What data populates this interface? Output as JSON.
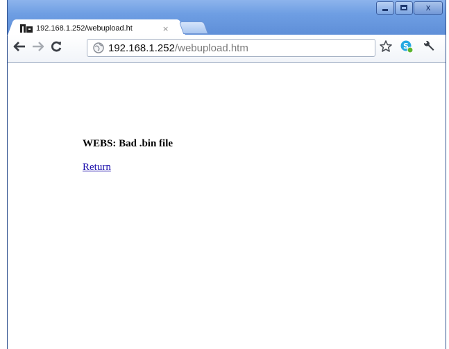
{
  "browser": {
    "tab": {
      "title": "192.168.1.252/webupload.ht",
      "close_glyph": "×",
      "favicon": "network-device-icon"
    },
    "controls": {
      "minimize": "minimize-icon",
      "maximize": "maximize-icon",
      "close": "close-icon",
      "close_glyph": "x"
    },
    "toolbar": {
      "back": "back-arrow-icon",
      "forward": "forward-arrow-icon",
      "reload": "reload-icon",
      "bookmark": "star-icon",
      "extension": "skype-extension-icon",
      "settings": "wrench-icon"
    },
    "address": {
      "host": "192.168.1.252",
      "path": "/webupload.htm"
    }
  },
  "page": {
    "message": "WEBS: Bad .bin file",
    "link_label": "Return"
  },
  "colors": {
    "frame": "#5a86d0",
    "link": "#1a0dab"
  }
}
